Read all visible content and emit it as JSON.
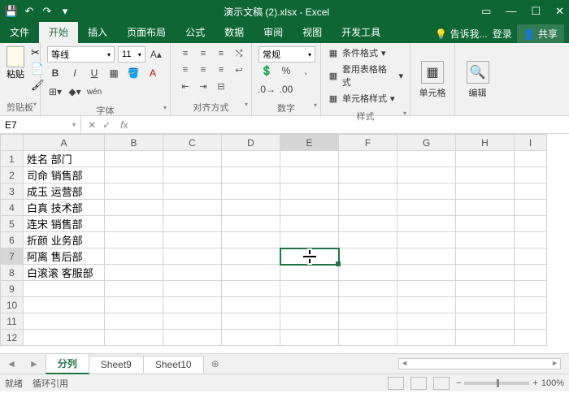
{
  "titlebar": {
    "title": "演示文稿 (2).xlsx - Excel"
  },
  "tabs": {
    "file": "文件",
    "home": "开始",
    "insert": "插入",
    "layout": "页面布局",
    "formula": "公式",
    "data": "数据",
    "review": "审阅",
    "view": "视图",
    "dev": "开发工具",
    "tell": "告诉我...",
    "login": "登录",
    "share": "共享"
  },
  "ribbon": {
    "clipboard": {
      "paste": "粘贴",
      "label": "剪贴板"
    },
    "font": {
      "name": "等线",
      "size": "11",
      "label": "字体"
    },
    "align": {
      "label": "对齐方式"
    },
    "number": {
      "format": "常规",
      "label": "数字"
    },
    "styles": {
      "cond": "条件格式",
      "table": "套用表格格式",
      "cell": "单元格样式",
      "label": "样式"
    },
    "cells": {
      "btn": "单元格"
    },
    "edit": {
      "btn": "编辑"
    }
  },
  "namebox": {
    "ref": "E7"
  },
  "columns": [
    "A",
    "B",
    "C",
    "D",
    "E",
    "F",
    "G",
    "H",
    "I"
  ],
  "rows": [
    {
      "n": 1,
      "a": "姓名 部门"
    },
    {
      "n": 2,
      "a": "司命 销售部"
    },
    {
      "n": 3,
      "a": "成玉 运营部"
    },
    {
      "n": 4,
      "a": "白真 技术部"
    },
    {
      "n": 5,
      "a": "连宋 销售部"
    },
    {
      "n": 6,
      "a": "折颜 业务部"
    },
    {
      "n": 7,
      "a": "阿离 售后部"
    },
    {
      "n": 8,
      "a": "白滚滚 客服部"
    },
    {
      "n": 9,
      "a": ""
    },
    {
      "n": 10,
      "a": ""
    },
    {
      "n": 11,
      "a": ""
    },
    {
      "n": 12,
      "a": ""
    }
  ],
  "sheets": {
    "s1": "分列",
    "s2": "Sheet9",
    "s3": "Sheet10"
  },
  "status": {
    "ready": "就绪",
    "circ": "循环引用",
    "zoom": "100%"
  }
}
